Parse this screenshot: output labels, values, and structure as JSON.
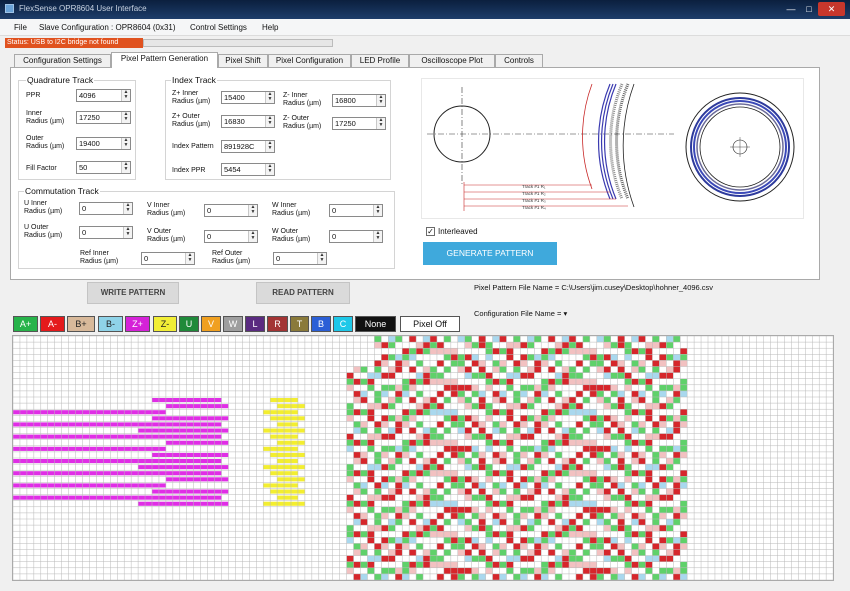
{
  "window": {
    "title": "FlexSense OPR8604 User Interface",
    "min_glyph": "—",
    "max_glyph": "□",
    "close_glyph": "✕"
  },
  "menu": [
    "File",
    "Slave Configuration : OPR8604 (0x31)",
    "Control Settings",
    "Help"
  ],
  "status": {
    "text": "Status: USB to I2C bridge not found",
    "progress": 0
  },
  "tabs": [
    "Configuration Settings",
    "Pixel Pattern Generation",
    "Pixel Shift",
    "Pixel Configuration",
    "LED Profile",
    "Oscilloscope Plot",
    "Controls"
  ],
  "active_tab": 1,
  "quadrature": {
    "title": "Quadrature Track",
    "ppr": {
      "label": "PPR",
      "value": "4096"
    },
    "inner": {
      "label": "Inner\nRadius (µm)",
      "value": "17250"
    },
    "outer": {
      "label": "Outer\nRadius (µm)",
      "value": "19400"
    },
    "fill": {
      "label": "Fill Factor",
      "value": "50"
    }
  },
  "index": {
    "title": "Index Track",
    "zp_inner": {
      "label": "Z+ Inner\nRadius (µm)",
      "value": "15400"
    },
    "zp_outer": {
      "label": "Z+ Outer\nRadius (µm)",
      "value": "16830"
    },
    "zm_inner": {
      "label": "Z- Inner\nRadius (µm)",
      "value": "16800"
    },
    "zm_outer": {
      "label": "Z- Outer\nRadius (µm)",
      "value": "17250"
    },
    "pattern": {
      "label": "Index Pattern",
      "value": "891928C"
    },
    "ppr": {
      "label": "Index PPR",
      "value": "5454"
    }
  },
  "commutation": {
    "title": "Commutation Track",
    "u_inner": {
      "label": "U Inner\nRadius (µm)",
      "value": "0"
    },
    "u_outer": {
      "label": "U Outer\nRadius (µm)",
      "value": "0"
    },
    "v_inner": {
      "label": "V Inner\nRadius (µm)",
      "value": "0"
    },
    "v_outer": {
      "label": "V Outer\nRadius (µm)",
      "value": "0"
    },
    "w_inner": {
      "label": "W Inner\nRadius (µm)",
      "value": "0"
    },
    "w_outer": {
      "label": "W Outer\nRadius (µm)",
      "value": "0"
    },
    "ref_inner": {
      "label": "Ref Inner\nRadius (µm)",
      "value": "0"
    },
    "ref_outer": {
      "label": "Ref Outer\nRadius (µm)",
      "value": "0"
    }
  },
  "preview": {
    "track_labels": [
      "Track #1 R₁",
      "Track #1 R₂",
      "Track #1 R₃",
      "Track #1 R₄"
    ]
  },
  "interleaved": {
    "label": "Interleaved",
    "checked": true
  },
  "buttons": {
    "generate": "GENERATE PATTERN",
    "write": "WRITE PATTERN",
    "read": "READ PATTERN"
  },
  "file_info": {
    "pixel_pattern": "Pixel Pattern File Name = C:\\Users\\jim.cusey\\Desktop\\hohner_4096.csv",
    "config": "Configuration File Name ="
  },
  "color_buttons": [
    {
      "label": "A+",
      "bg": "#27b34a",
      "fg": "#ffffff"
    },
    {
      "label": "A-",
      "bg": "#e41a1c",
      "fg": "#ffffff"
    },
    {
      "label": "B+",
      "bg": "#d8b99a",
      "fg": "#222222"
    },
    {
      "label": "B-",
      "bg": "#8fd3e8",
      "fg": "#222222"
    },
    {
      "label": "Z+",
      "bg": "#d522d8",
      "fg": "#ffffff"
    },
    {
      "label": "Z-",
      "bg": "#f2ee36",
      "fg": "#222222"
    },
    {
      "label": "U",
      "bg": "#1f8a3a",
      "fg": "#ffffff"
    },
    {
      "label": "V",
      "bg": "#f0a020",
      "fg": "#ffffff"
    },
    {
      "label": "W",
      "bg": "#9e9e9e",
      "fg": "#ffffff"
    },
    {
      "label": "L",
      "bg": "#5a2b80",
      "fg": "#ffffff"
    },
    {
      "label": "R",
      "bg": "#a33434",
      "fg": "#ffffff"
    },
    {
      "label": "T",
      "bg": "#8a7a3a",
      "fg": "#ffffff"
    },
    {
      "label": "B",
      "bg": "#2b5fd6",
      "fg": "#ffffff"
    },
    {
      "label": "C",
      "bg": "#1ec8e8",
      "fg": "#ffffff"
    },
    {
      "label": "None",
      "bg": "#111111",
      "fg": "#ffffff"
    },
    {
      "label": "Pixel Off",
      "bg": "#ffffff",
      "fg": "#111111"
    }
  ],
  "pattern_colors": {
    "grid": "#b9b9b9",
    "magenta": "#e02ee6",
    "yellow": "#f3ee2f",
    "red": "#d6262b",
    "green": "#5fd16a",
    "light_blue": "#a9d8ee",
    "pink": "#f2c1c1"
  }
}
